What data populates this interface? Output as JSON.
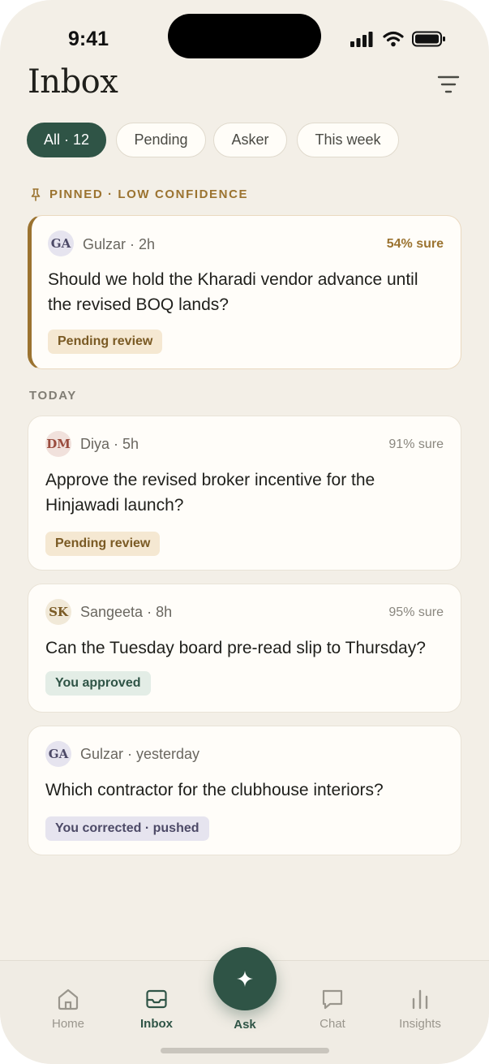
{
  "status": {
    "time": "9:41"
  },
  "header": {
    "title": "Inbox"
  },
  "filters": [
    {
      "label": "All · 12",
      "active": true
    },
    {
      "label": "Pending",
      "active": false
    },
    {
      "label": "Asker",
      "active": false
    },
    {
      "label": "This week",
      "active": false
    }
  ],
  "sections": {
    "pinned": "PINNED · LOW CONFIDENCE",
    "today": "TODAY"
  },
  "items": [
    {
      "initials": "GA",
      "meta": "Gulzar · 2h",
      "confidence": "54% sure",
      "question": "Should we hold the Kharadi vendor advance until the revised BOQ lands?",
      "badge": "Pending review"
    },
    {
      "initials": "DM",
      "meta": "Diya · 5h",
      "confidence": "91% sure",
      "question": "Approve the revised broker incentive for the Hinjawadi launch?",
      "badge": "Pending review"
    },
    {
      "initials": "SK",
      "meta": "Sangeeta · 8h",
      "confidence": "95% sure",
      "question": "Can the Tuesday board pre-read slip to Thursday?",
      "badge": "You approved"
    },
    {
      "initials": "GA",
      "meta": "Gulzar · yesterday",
      "confidence": "",
      "question": "Which contractor for the clubhouse interiors?",
      "badge": "You corrected · pushed"
    }
  ],
  "tabbar": {
    "home": "Home",
    "inbox": "Inbox",
    "ask": "Ask",
    "chat": "Chat",
    "insights": "Insights"
  },
  "colors": {
    "accent": "#2f5446",
    "warning": "#9b7330",
    "background": "#f3efe7"
  }
}
